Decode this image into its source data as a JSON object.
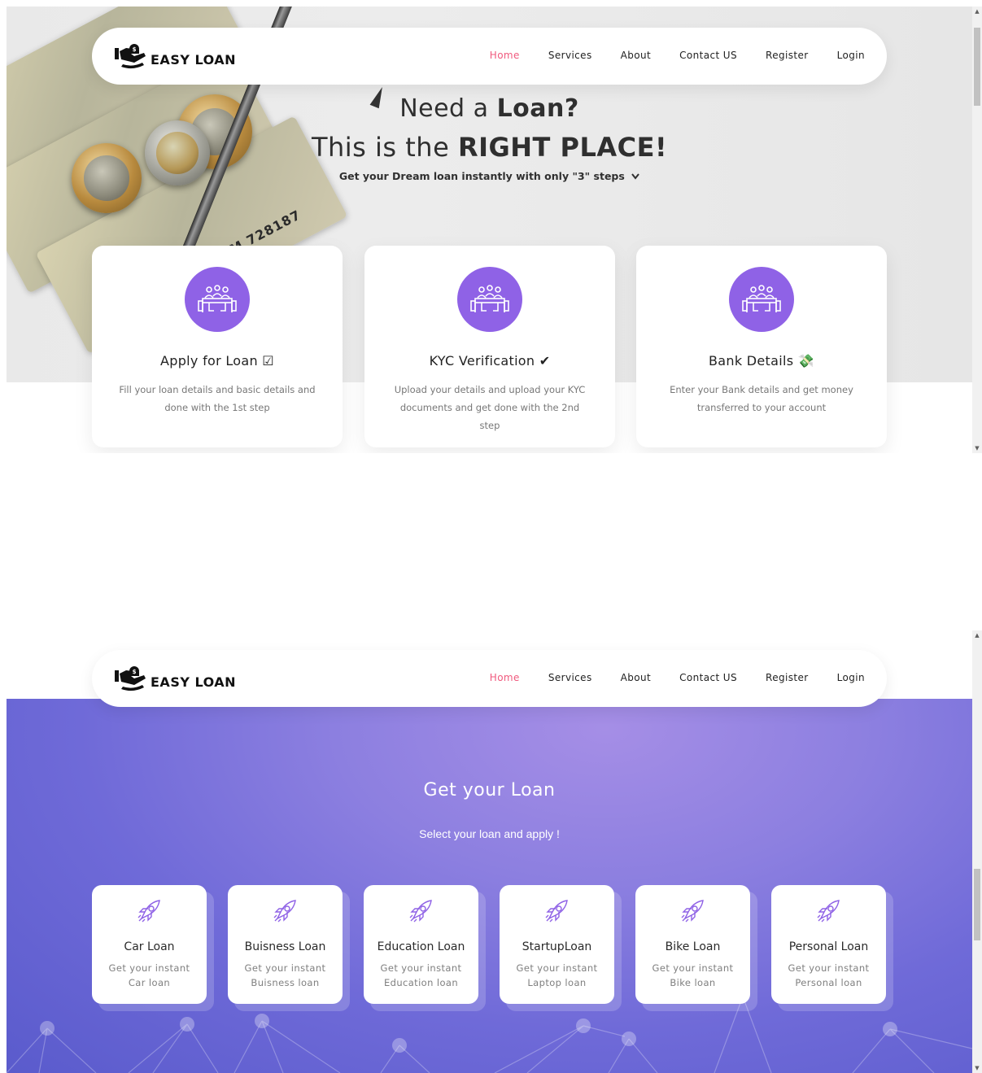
{
  "brand": {
    "name": "EASY LOAN",
    "logo_icon": "hand-money-icon"
  },
  "nav": {
    "items": [
      {
        "label": "Home",
        "active": true
      },
      {
        "label": "Services",
        "active": false
      },
      {
        "label": "About",
        "active": false
      },
      {
        "label": "Contact US",
        "active": false
      },
      {
        "label": "Register",
        "active": false
      },
      {
        "label": "Login",
        "active": false
      }
    ],
    "active_color": "#f05a7e"
  },
  "hero": {
    "line1_prefix": "Need a ",
    "line1_bold": "Loan?",
    "line2_prefix": "This is the ",
    "line2_bold": "RIGHT PLACE!",
    "subtitle": "Get your Dream loan instantly with only \"3\" steps",
    "subtitle_icon": "chevron-down-icon"
  },
  "steps": [
    {
      "title": "Apply for Loan ☑",
      "description": "Fill your loan details and basic details and done with the 1st step",
      "icon": "meeting-table-icon"
    },
    {
      "title": "KYC Verification ✔",
      "description": "Upload your details and upload your KYC documents and get done with the 2nd step",
      "icon": "meeting-table-icon"
    },
    {
      "title": "Bank Details 💸",
      "description": "Enter your Bank details and get money transferred to your account",
      "icon": "meeting-table-icon"
    }
  ],
  "services": {
    "title": "Get your Loan",
    "subtitle": "Select your loan and apply !",
    "cards": [
      {
        "title": "Car Loan",
        "description": "Get your instant Car loan",
        "icon": "rocket-icon"
      },
      {
        "title": "Buisness Loan",
        "description": "Get your instant Buisness loan",
        "icon": "rocket-icon"
      },
      {
        "title": "Education Loan",
        "description": "Get your instant Education loan",
        "icon": "rocket-icon"
      },
      {
        "title": "StartupLoan",
        "description": "Get your instant Laptop loan",
        "icon": "rocket-icon"
      },
      {
        "title": "Bike Loan",
        "description": "Get your instant Bike loan",
        "icon": "rocket-icon"
      },
      {
        "title": "Personal Loan",
        "description": "Get your instant Personal loan",
        "icon": "rocket-icon"
      }
    ]
  },
  "colors": {
    "accent_purple": "#8f62e6",
    "section_gradient": "#6f6ad8",
    "text_dark": "#222222"
  },
  "scrollbar": {
    "frame1_thumb_fraction": 0.12,
    "frame2_thumb_fraction": 0.16
  }
}
